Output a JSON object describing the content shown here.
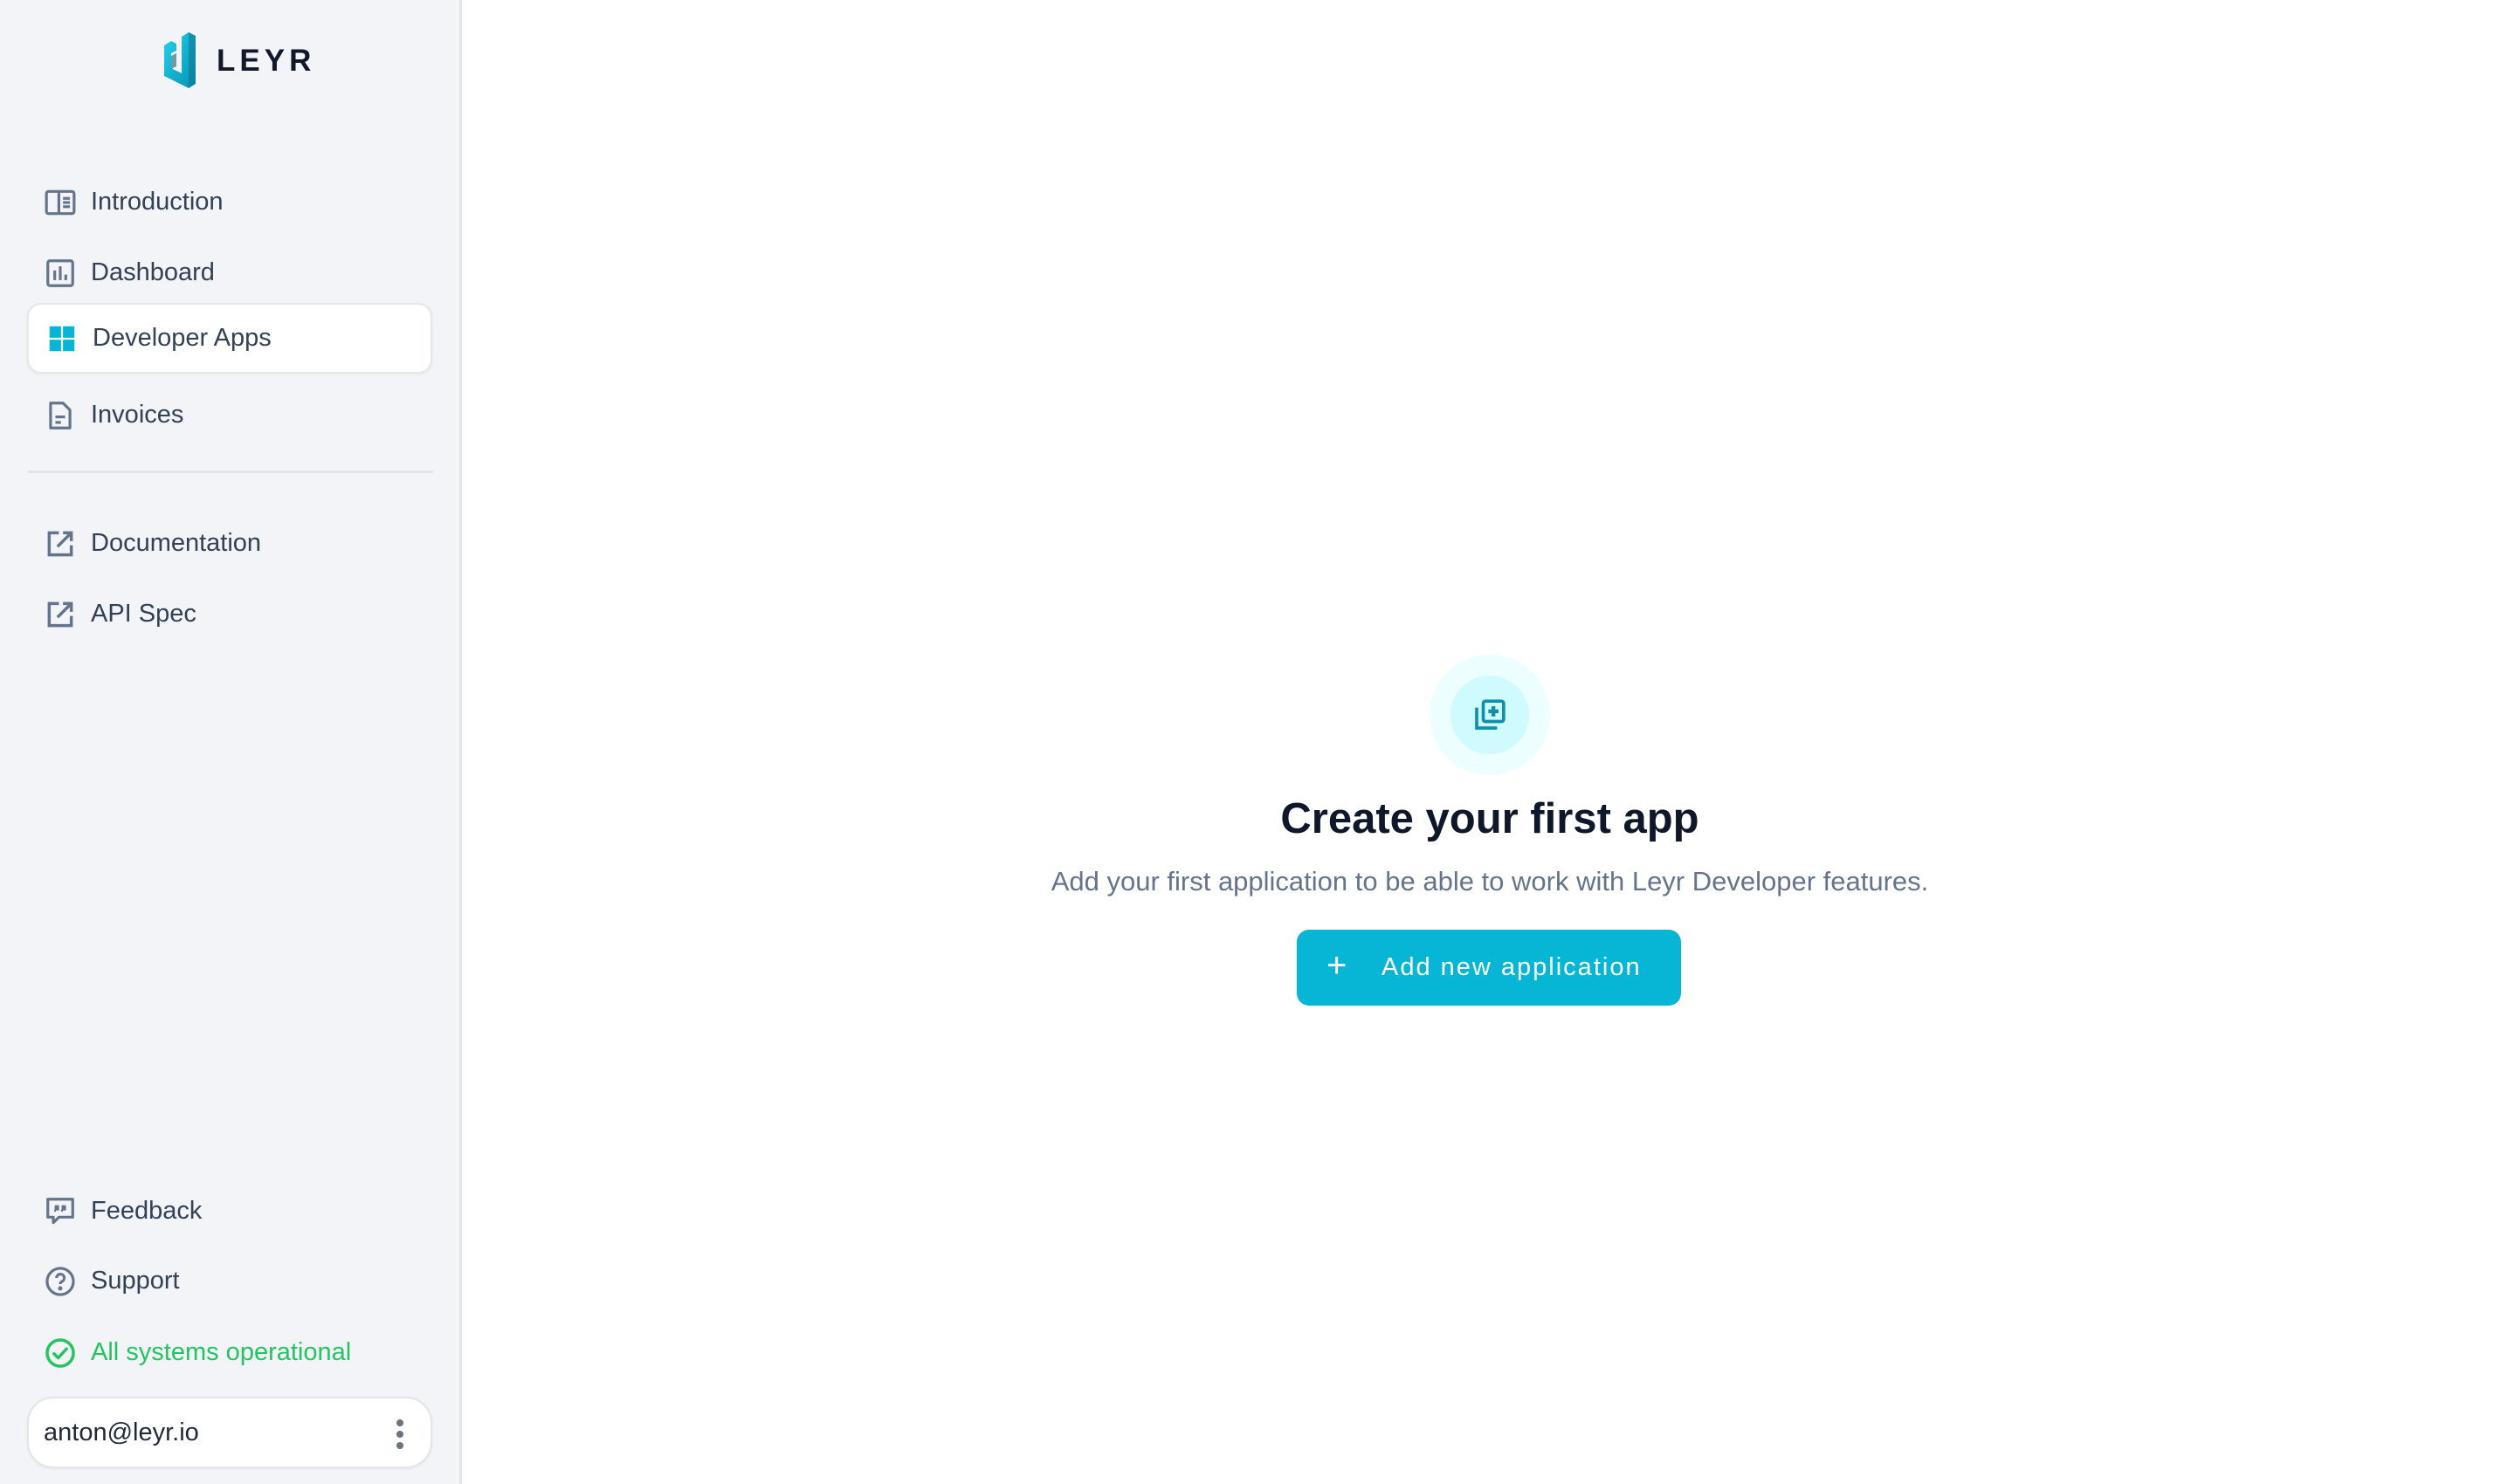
{
  "brand": {
    "name": "LEYR",
    "accent": "#06b6d4"
  },
  "sidebar": {
    "primary_nav": [
      {
        "label": "Introduction",
        "icon": "book-open-icon",
        "active": false
      },
      {
        "label": "Dashboard",
        "icon": "bar-chart-icon",
        "active": false
      },
      {
        "label": "Developer Apps",
        "icon": "apps-grid-icon",
        "active": true
      },
      {
        "label": "Invoices",
        "icon": "document-icon",
        "active": false
      }
    ],
    "external_links": [
      {
        "label": "Documentation",
        "icon": "external-link-icon"
      },
      {
        "label": "API Spec",
        "icon": "external-link-icon"
      }
    ],
    "footer_nav": [
      {
        "label": "Feedback",
        "icon": "quote-bubble-icon"
      },
      {
        "label": "Support",
        "icon": "question-circle-icon"
      }
    ],
    "status": {
      "label": "All systems operational",
      "icon": "check-circle-icon",
      "color": "#22c55e"
    },
    "user": {
      "email": "anton@leyr.io",
      "menu_icon": "kebab-menu-icon"
    }
  },
  "main": {
    "empty_state": {
      "icon": "add-collection-icon",
      "title": "Create your first app",
      "subtitle": "Add your first application to be able to work with Leyr Developer features.",
      "button": {
        "icon": "+",
        "label": "Add new application"
      }
    }
  }
}
